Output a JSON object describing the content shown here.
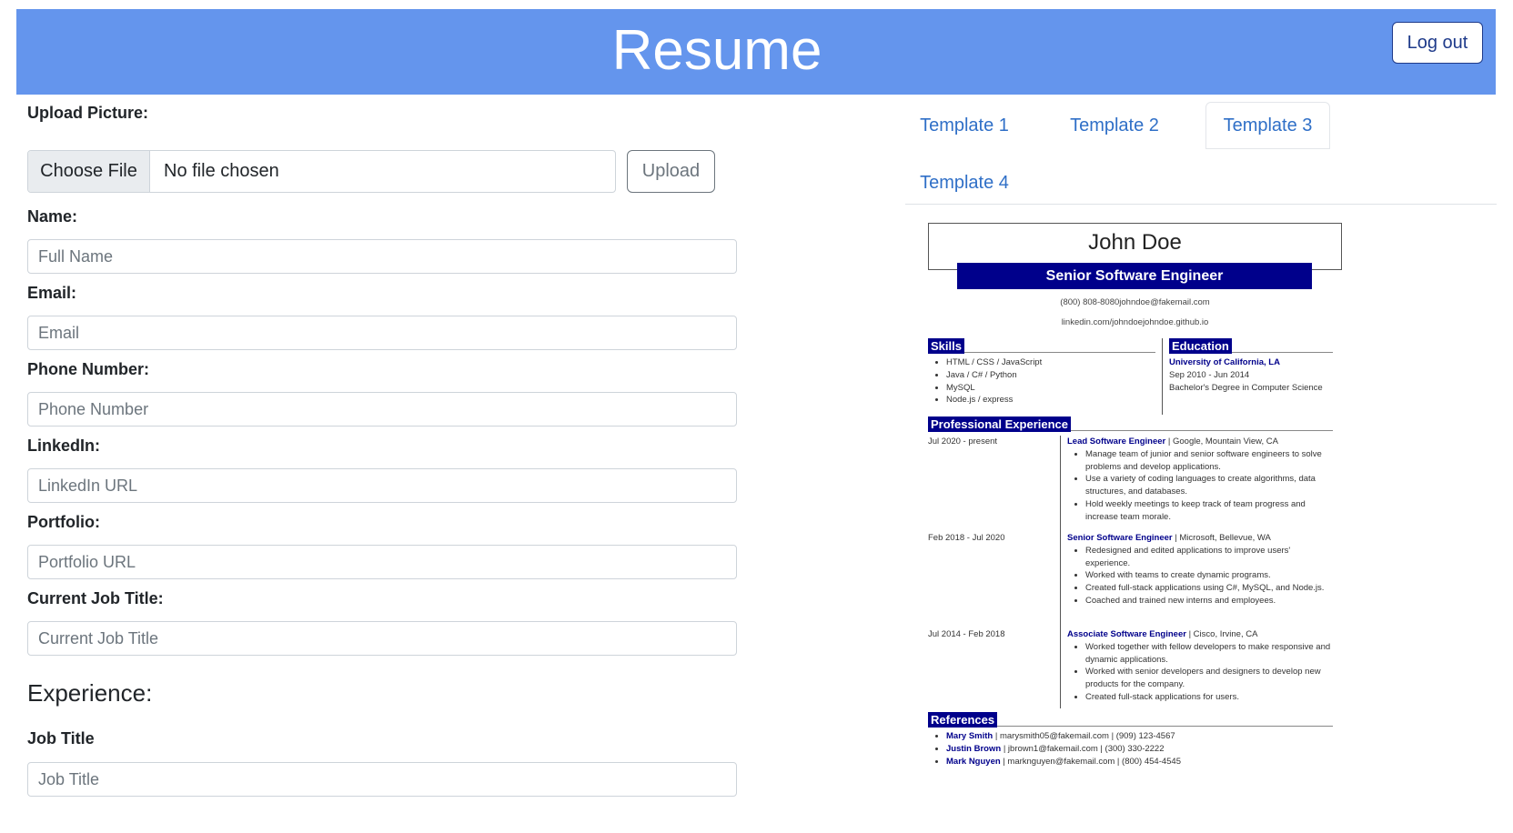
{
  "header": {
    "title": "Resume",
    "logout_label": "Log out"
  },
  "form": {
    "upload_picture_label": "Upload Picture:",
    "choose_file_label": "Choose File",
    "file_status": "No file chosen",
    "upload_label": "Upload",
    "fields": [
      {
        "label": "Name:",
        "placeholder": "Full Name"
      },
      {
        "label": "Email:",
        "placeholder": "Email"
      },
      {
        "label": "Phone Number:",
        "placeholder": "Phone Number"
      },
      {
        "label": "LinkedIn:",
        "placeholder": "LinkedIn URL"
      },
      {
        "label": "Portfolio:",
        "placeholder": "Portfolio URL"
      },
      {
        "label": "Current Job Title:",
        "placeholder": "Current Job Title"
      }
    ],
    "experience_heading": "Experience:",
    "job_title_label": "Job Title",
    "job_title_placeholder": "Job Title"
  },
  "tabs": [
    {
      "label": "Template 1",
      "active": false
    },
    {
      "label": "Template 2",
      "active": false
    },
    {
      "label": "Template 3",
      "active": true
    },
    {
      "label": "Template 4",
      "active": false
    }
  ],
  "resume": {
    "name": "John Doe",
    "title": "Senior Software Engineer",
    "contact_line1": "(800) 808-8080johndoe@fakemail.com",
    "contact_line2": "linkedin.com/johndoejohndoe.github.io",
    "skills_heading": "Skills",
    "skills": [
      "HTML / CSS / JavaScript",
      "Java / C# / Python",
      "MySQL",
      "Node.js / express"
    ],
    "education_heading": "Education",
    "education": {
      "school": "University of California, LA",
      "dates": "Sep 2010 - Jun 2014",
      "degree": "Bachelor's Degree in Computer Science"
    },
    "experience_heading": "Professional Experience",
    "jobs": [
      {
        "dates": "Jul 2020 - present",
        "title": "Lead Software Engineer",
        "company": "| Google, Mountain View, CA",
        "bullets": [
          "Manage team of junior and senior software engineers to solve problems and develop applications.",
          "Use a variety of coding languages to create algorithms, data structures, and databases.",
          "Hold weekly meetings to keep track of team progress and increase team morale."
        ]
      },
      {
        "dates": "Feb 2018 - Jul 2020",
        "title": "Senior Software Engineer",
        "company": "| Microsoft, Bellevue, WA",
        "bullets": [
          "Redesigned and edited applications to improve users' experience.",
          "Worked with teams to create dynamic programs.",
          "Created full-stack applications using C#, MySQL, and Node.js.",
          "Coached and trained new interns and employees."
        ]
      },
      {
        "dates": "Jul 2014 - Feb 2018",
        "title": "Associate Software Engineer",
        "company": "| Cisco, Irvine, CA",
        "bullets": [
          "Worked together with fellow developers to make responsive and dynamic applications.",
          "Worked with senior developers and designers to develop new products for the company.",
          "Created full-stack applications for users."
        ]
      }
    ],
    "references_heading": "References",
    "references": [
      {
        "name": "Mary Smith",
        "detail": "|  marysmith05@fakemail.com  |  (909) 123-4567"
      },
      {
        "name": "Justin Brown",
        "detail": "|  jbrown1@fakemail.com  |  (300) 330-2222"
      },
      {
        "name": "Mark Nguyen",
        "detail": "|  marknguyen@fakemail.com  |  (800) 454-4545"
      }
    ]
  }
}
